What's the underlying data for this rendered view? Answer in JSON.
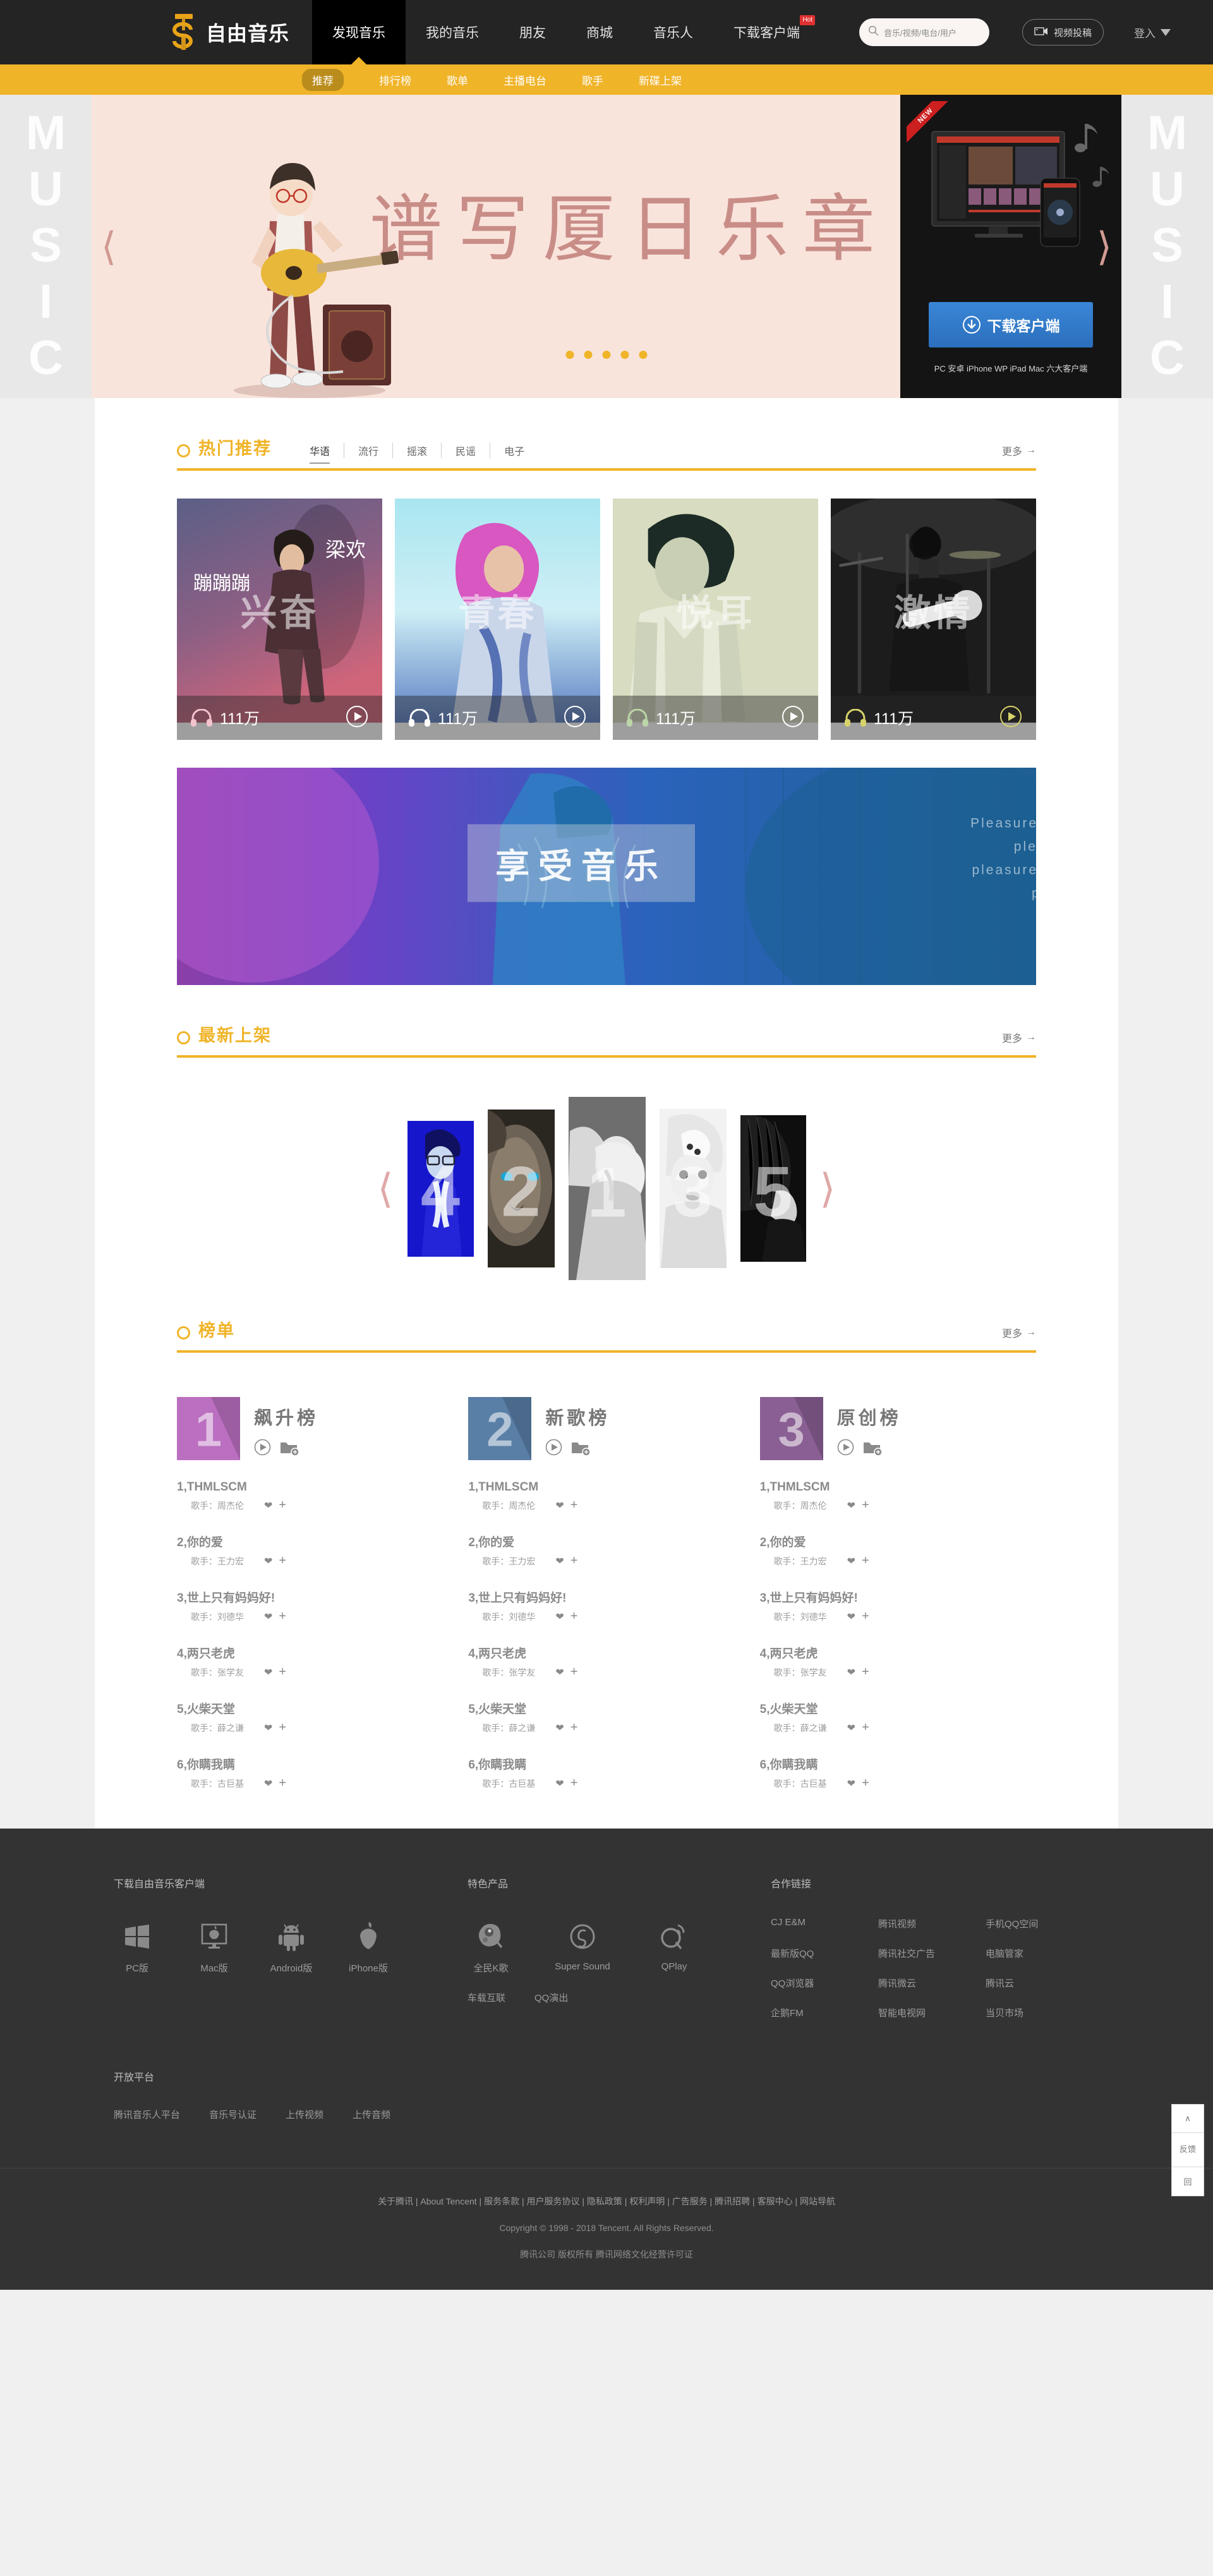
{
  "header": {
    "brand": "自由音乐",
    "nav": [
      {
        "label": "发现音乐",
        "active": true,
        "badge": ""
      },
      {
        "label": "我的音乐",
        "active": false,
        "badge": ""
      },
      {
        "label": "朋友",
        "active": false,
        "badge": ""
      },
      {
        "label": "商城",
        "active": false,
        "badge": ""
      },
      {
        "label": "音乐人",
        "active": false,
        "badge": ""
      },
      {
        "label": "下载客户端",
        "active": false,
        "badge": "Hot"
      }
    ],
    "search_placeholder": "音乐/视频/电台/用户",
    "video_upload_label": "视频投稿",
    "login_label": "登入"
  },
  "subnav": [
    {
      "label": "推荐",
      "active": true
    },
    {
      "label": "排行榜",
      "active": false
    },
    {
      "label": "歌单",
      "active": false
    },
    {
      "label": "主播电台",
      "active": false
    },
    {
      "label": "歌手",
      "active": false
    },
    {
      "label": "新碟上架",
      "active": false
    }
  ],
  "hero": {
    "side_word_left": "MUSIC",
    "side_word_right": "MUSIC",
    "title": "谱写厦日乐章",
    "dot_count": 5,
    "download": {
      "flag": "NEW",
      "button_label": "下载客户端",
      "caption": "PC 安卓 iPhone WP iPad Mac 六大客户端"
    }
  },
  "hot": {
    "title": "热门推荐",
    "tabs": [
      {
        "label": "华语",
        "active": true
      },
      {
        "label": "流行",
        "active": false
      },
      {
        "label": "摇滚",
        "active": false
      },
      {
        "label": "民谣",
        "active": false
      },
      {
        "label": "电子",
        "active": false
      }
    ],
    "more": "更多",
    "cards": [
      {
        "word": "兴奋",
        "side_a": "梁欢",
        "side_b": "蹦蹦蹦",
        "plays": "111万",
        "accent": "#f2c3cd"
      },
      {
        "word": "青春",
        "side_a": "",
        "side_b": "",
        "plays": "111万",
        "accent": "#ffffff"
      },
      {
        "word": "悦耳",
        "side_a": "",
        "side_b": "",
        "plays": "111万",
        "accent": "#bcd6a8"
      },
      {
        "word": "激情",
        "side_a": "",
        "side_b": "",
        "plays": "111万",
        "accent": "#d7d36a"
      }
    ]
  },
  "banner": {
    "word": "享受音乐",
    "en_lines": [
      "Pleasure w",
      "pleas",
      "pleasure w",
      "ple"
    ]
  },
  "newest": {
    "title": "最新上架",
    "more": "更多",
    "items": [
      {
        "num": "4"
      },
      {
        "num": "2"
      },
      {
        "num": "1"
      },
      {
        "num": "3"
      },
      {
        "num": "5"
      }
    ]
  },
  "ranking": {
    "title": "榜单",
    "more": "更多",
    "artist_label": "歌手：",
    "charts": [
      {
        "num": "1",
        "name": "飙升榜",
        "color": "#bb6fc0",
        "songs": [
          {
            "rank": "1",
            "title": "THMLSCM",
            "artist": "周杰伦"
          },
          {
            "rank": "2",
            "title": "你的爱",
            "artist": "王力宏"
          },
          {
            "rank": "3",
            "title": "世上只有妈妈好!",
            "artist": "刘德华"
          },
          {
            "rank": "4",
            "title": "两只老虎",
            "artist": "张学友"
          },
          {
            "rank": "5",
            "title": "火柴天堂",
            "artist": "薛之谦"
          },
          {
            "rank": "6",
            "title": "你瞒我瞒",
            "artist": "古巨基"
          }
        ]
      },
      {
        "num": "2",
        "name": "新歌榜",
        "color": "#5a7fa6",
        "songs": [
          {
            "rank": "1",
            "title": "THMLSCM",
            "artist": "周杰伦"
          },
          {
            "rank": "2",
            "title": "你的爱",
            "artist": "王力宏"
          },
          {
            "rank": "3",
            "title": "世上只有妈妈好!",
            "artist": "刘德华"
          },
          {
            "rank": "4",
            "title": "两只老虎",
            "artist": "张学友"
          },
          {
            "rank": "5",
            "title": "火柴天堂",
            "artist": "薛之谦"
          },
          {
            "rank": "6",
            "title": "你瞒我瞒",
            "artist": "古巨基"
          }
        ]
      },
      {
        "num": "3",
        "name": "原创榜",
        "color": "#8a5f93",
        "songs": [
          {
            "rank": "1",
            "title": "THMLSCM",
            "artist": "周杰伦"
          },
          {
            "rank": "2",
            "title": "你的爱",
            "artist": "王力宏"
          },
          {
            "rank": "3",
            "title": "世上只有妈妈好!",
            "artist": "刘德华"
          },
          {
            "rank": "4",
            "title": "两只老虎",
            "artist": "张学友"
          },
          {
            "rank": "5",
            "title": "火柴天堂",
            "artist": "薛之谦"
          },
          {
            "rank": "6",
            "title": "你瞒我瞒",
            "artist": "古巨基"
          }
        ]
      }
    ]
  },
  "footer": {
    "download_head": "下载自由音乐客户端",
    "download_items": [
      {
        "label": "PC版",
        "icon": "windows-icon"
      },
      {
        "label": "Mac版",
        "icon": "imac-icon"
      },
      {
        "label": "Android版",
        "icon": "android-icon"
      },
      {
        "label": "iPhone版",
        "icon": "apple-icon"
      }
    ],
    "products_head": "特色产品",
    "products": [
      {
        "label": "全民K歌",
        "icon": "kge-icon"
      },
      {
        "label": "Super Sound",
        "icon": "supersound-icon"
      },
      {
        "label": "QPlay",
        "icon": "qplay-icon"
      }
    ],
    "products_row2": [
      "车载互联",
      "QQ演出"
    ],
    "links_head": "合作链接",
    "links": [
      "CJ E&M",
      "腾讯视频",
      "手机QQ空间",
      "最新版QQ",
      "腾讯社交广告",
      "电脑管家",
      "QQ浏览器",
      "腾讯微云",
      "腾讯云",
      "企鹅FM",
      "智能电视网",
      "当贝市场"
    ],
    "open_head": "开放平台",
    "open_links": [
      "腾讯音乐人平台",
      "音乐号认证",
      "上传视频",
      "上传音频"
    ],
    "legal": "关于腾讯 | About Tencent | 服务条款 | 用户服务协议 | 隐私政策 | 权利声明 | 广告服务 | 腾讯招聘 | 客服中心 | 网站导航",
    "copyright": "Copyright © 1998 - 2018 Tencent. All Rights Reserved.",
    "license": "腾讯公司 版权所有 腾讯网络文化经营许可证"
  },
  "sidewidget": {
    "top_label": "∧",
    "feedback_label": "反馈",
    "qr_label": "回"
  }
}
